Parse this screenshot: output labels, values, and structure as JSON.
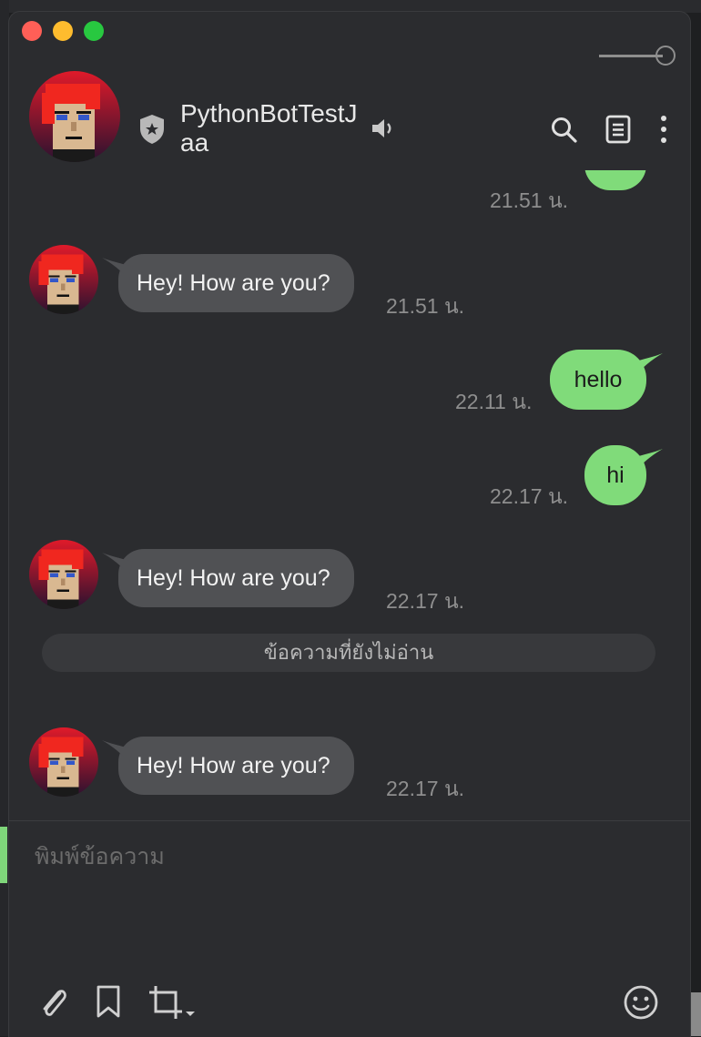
{
  "window": {
    "pin_state": "pinned"
  },
  "header": {
    "contact_name": "PythonBotTestJaa",
    "icons": [
      "shield-icon",
      "speaker-icon",
      "search-icon",
      "notes-icon",
      "more-icon"
    ]
  },
  "messages": {
    "clipped_time": "21.51 น.",
    "items": [
      {
        "direction": "incoming",
        "text": "Hey! How are you?",
        "time": "21.51 น."
      },
      {
        "direction": "outgoing",
        "text": "hello",
        "time": "22.11 น."
      },
      {
        "direction": "outgoing",
        "text": "hi",
        "time": "22.17 น."
      },
      {
        "direction": "incoming",
        "text": "Hey! How are you?",
        "time": "22.17 น."
      },
      {
        "direction": "incoming",
        "text": "Hey! How are you?",
        "time": "22.17 น."
      }
    ],
    "unread_divider": "ข้อความที่ยังไม่อ่าน"
  },
  "composer": {
    "placeholder": "พิมพ์ข้อความ",
    "value": ""
  },
  "colors": {
    "incoming_bubble": "#505154",
    "outgoing_bubble": "#80db7a",
    "window_bg": "#2b2c2f"
  }
}
